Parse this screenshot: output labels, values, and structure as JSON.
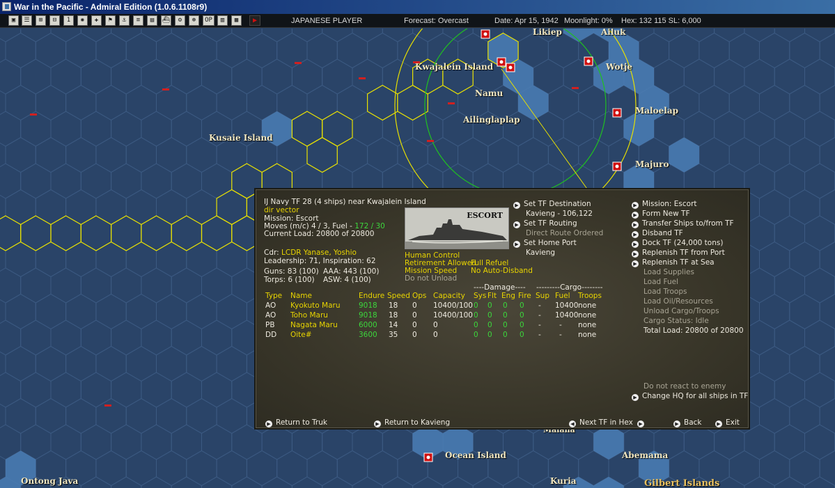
{
  "window": {
    "title": "War in the Pacific - Admiral Edition (1.0.6.1108r9)"
  },
  "toolbar": {
    "buttons": [
      "▣",
      "☰",
      "⊞",
      "⊟",
      "1",
      "✺",
      "✚",
      "⚑",
      "⚓",
      "≡",
      "▤",
      "⛴",
      "⚙",
      "⊛",
      "OP",
      "▥",
      "▦"
    ],
    "play_icon": "play-icon",
    "player": "JAPANESE PLAYER",
    "forecast": "Forecast: Overcast",
    "date": "Date: Apr 15, 1942",
    "moonlight": "Moonlight: 0%",
    "hex": "Hex: 132 115  SL: 6,000"
  },
  "map": {
    "labels": [
      {
        "name": "Likiep"
      },
      {
        "name": "Ailuk"
      },
      {
        "name": "Kwajalein Island"
      },
      {
        "name": "Wotje"
      },
      {
        "name": "Namu"
      },
      {
        "name": "Maloelap"
      },
      {
        "name": "Ailinglaplap"
      },
      {
        "name": "Kusaie Island"
      },
      {
        "name": "Majuro"
      },
      {
        "name": "Ocean Island"
      },
      {
        "name": "Abemama"
      },
      {
        "name": "Ontong Java"
      },
      {
        "name": "Kuria"
      },
      {
        "name": "Gilbert Islands"
      },
      {
        "name": "Maiana"
      }
    ],
    "colors": {
      "sea": "#2a4468",
      "hexline": "#3c5a82",
      "route": "#e8e000",
      "range_inner": "#20c020",
      "range_outer": "#e8e000",
      "island": "#4f86c0",
      "base": "#d01010"
    }
  },
  "panel": {
    "header": "IJ Navy TF 28 (4 ships)  near Kwajalein Island",
    "vector": "dir vector",
    "mission": "Mission: Escort",
    "moves_label": "Moves (m/c)  4 / 3, Fuel - ",
    "moves_fuel": "172 / 30",
    "current_load": "Current Load:  20800 of 20800",
    "cdr_label": "Cdr:  ",
    "cdr_name": "LCDR Yanase, Yoshio",
    "leadership": "Leadership: 71, Inspiration: 62",
    "guns": "Guns: 83 (100)",
    "aaa": "AAA: 443 (100)",
    "torps": "Torps: 6 (100)",
    "asw": "ASW: 4 (100)",
    "image_label": "ESCORT",
    "human_control": "Human Control",
    "retirement": "Retirement Allowed",
    "full_refuel": "Full Refuel",
    "mission_speed": "Mission Speed",
    "no_auto_disband": "No Auto-Disband",
    "do_not_unload": "Do not Unload",
    "set_destination": "Set TF Destination",
    "destination_value": "Kavieng - 106,122",
    "set_routing": "Set TF Routing",
    "direct_route": "Direct Route Ordered",
    "set_home_port": "Set Home Port",
    "home_port_value": "Kavieng",
    "right_menu": [
      {
        "label": "Mission: Escort",
        "active": true
      },
      {
        "label": "Form New TF",
        "active": true
      },
      {
        "label": "Transfer Ships to/from TF",
        "active": true
      },
      {
        "label": "Disband TF",
        "active": true
      },
      {
        "label": "Dock TF (24,000 tons)",
        "active": true
      },
      {
        "label": "Replenish TF from Port",
        "active": true
      },
      {
        "label": "Replenish TF at Sea",
        "active": true
      },
      {
        "label": "Load Supplies",
        "active": false
      },
      {
        "label": "Load Fuel",
        "active": false
      },
      {
        "label": "Load Troops",
        "active": false
      },
      {
        "label": "Load Oil/Resources",
        "active": false
      },
      {
        "label": "Unload Cargo/Troops",
        "active": false
      },
      {
        "label": "Cargo Status: Idle",
        "active": false
      },
      {
        "label": "Total Load: 20800 of 20800",
        "active": "text"
      }
    ],
    "do_not_react": "Do not react to enemy",
    "change_hq": "Change HQ for all ships in TF",
    "damage_header": "----Damage----",
    "cargo_header": "---------Cargo--------",
    "columns": [
      "Type",
      "Name",
      "Endure",
      "Speed",
      "Ops",
      "Capacity",
      "Sys",
      "Flt",
      "Eng",
      "Fire",
      "Sup",
      "Fuel",
      "Troops"
    ],
    "ships": [
      {
        "type": "AO",
        "name": "Kyokuto Maru",
        "endure": "9018",
        "speed": "18",
        "ops": "0",
        "capacity": "10400/100",
        "sys": "0",
        "flt": "0",
        "eng": "0",
        "fire": "0",
        "sup": "-",
        "fuel": "10400",
        "troops": "none"
      },
      {
        "type": "AO",
        "name": "Toho Maru",
        "endure": "9018",
        "speed": "18",
        "ops": "0",
        "capacity": "10400/100",
        "sys": "0",
        "flt": "0",
        "eng": "0",
        "fire": "0",
        "sup": "-",
        "fuel": "10400",
        "troops": "none"
      },
      {
        "type": "PB",
        "name": "Nagata Maru",
        "endure": "6000",
        "speed": "14",
        "ops": "0",
        "capacity": "0",
        "sys": "0",
        "flt": "0",
        "eng": "0",
        "fire": "0",
        "sup": "-",
        "fuel": "-",
        "troops": "none"
      },
      {
        "type": "DD",
        "name": "Oite#",
        "endure": "3600",
        "speed": "35",
        "ops": "0",
        "capacity": "0",
        "sys": "0",
        "flt": "0",
        "eng": "0",
        "fire": "0",
        "sup": "-",
        "fuel": "-",
        "troops": "none"
      }
    ],
    "return_truk": "Return to Truk",
    "return_kavieng": "Return to Kavieng",
    "next_tf": "Next TF in Hex",
    "back": "Back",
    "exit": "Exit"
  }
}
